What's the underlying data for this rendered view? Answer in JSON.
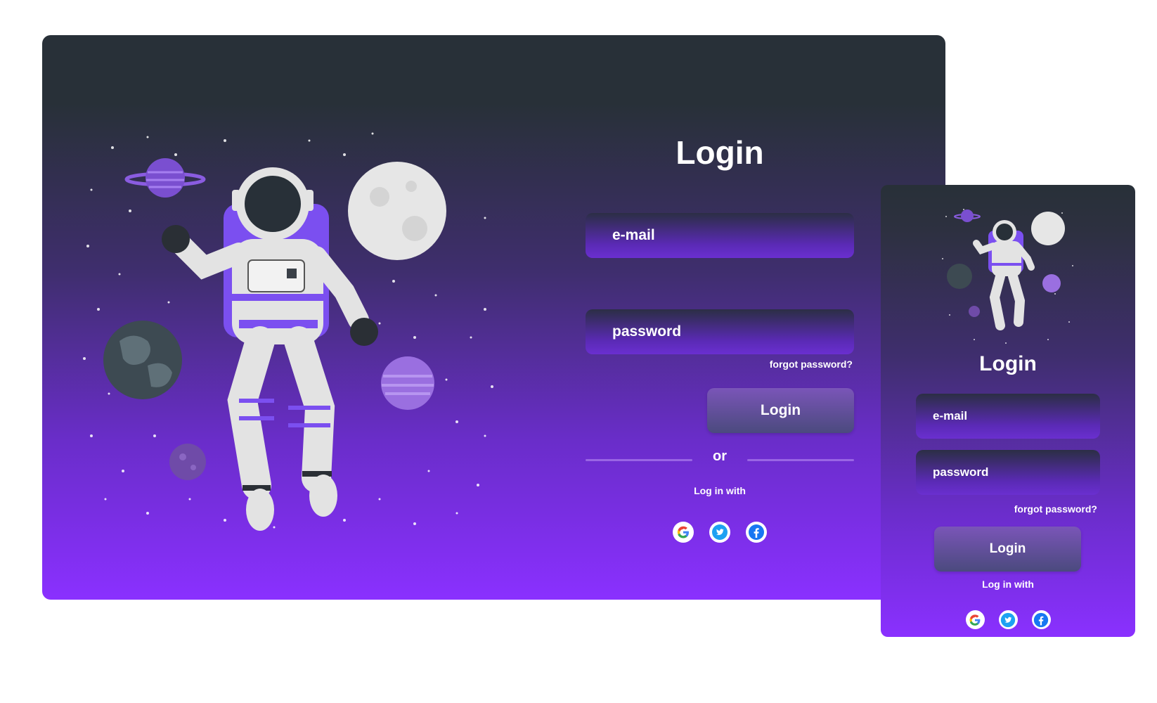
{
  "desktop": {
    "title": "Login",
    "email_placeholder": "e-mail",
    "password_placeholder": "password",
    "forgot_label": "forgot password?",
    "login_button": "Login",
    "or_label": "or",
    "login_with": "Log in with",
    "socials": [
      "google-icon",
      "twitter-icon",
      "facebook-icon"
    ]
  },
  "mobile": {
    "title": "Login",
    "email_placeholder": "e-mail",
    "password_placeholder": "password",
    "forgot_label": "forgot password?",
    "login_button": "Login",
    "login_with": "Log in with",
    "socials": [
      "google-icon",
      "twitter-icon",
      "facebook-icon"
    ]
  },
  "colors": {
    "bg_top": "#283038",
    "bg_bottom": "#8a30ff",
    "accent_purple": "#7b4ff0",
    "button": "#6a4fa8"
  }
}
